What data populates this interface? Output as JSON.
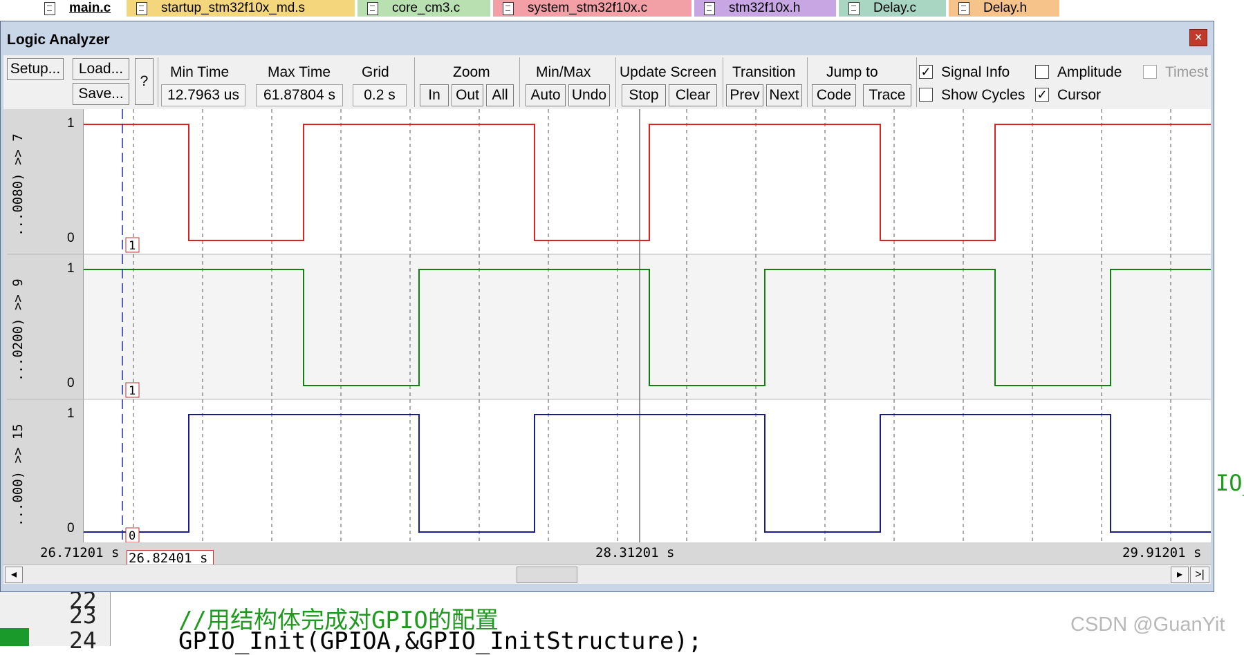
{
  "file_tabs": [
    {
      "label": "main.c",
      "color": "#ffffff",
      "active": true
    },
    {
      "label": "startup_stm32f10x_md.s",
      "color": "#f4d77c"
    },
    {
      "label": "core_cm3.c",
      "color": "#b9e0b0"
    },
    {
      "label": "system_stm32f10x.c",
      "color": "#f2a0a6"
    },
    {
      "label": "stm32f10x.h",
      "color": "#c8a6e4"
    },
    {
      "label": "Delay.c",
      "color": "#a9d6c2"
    },
    {
      "label": "Delay.h",
      "color": "#f6c38a"
    }
  ],
  "window": {
    "title": "Logic Analyzer",
    "close_label": "×"
  },
  "toolbar": {
    "setup_label": "Setup...",
    "load_label": "Load...",
    "save_label": "Save...",
    "help_label": "?",
    "min_time_label": "Min Time",
    "min_time_value": "12.7963 us",
    "max_time_label": "Max Time",
    "max_time_value": "61.87804 s",
    "grid_label": "Grid",
    "grid_value": "0.2 s",
    "zoom_label": "Zoom",
    "zoom_in": "In",
    "zoom_out": "Out",
    "zoom_all": "All",
    "minmax_label": "Min/Max",
    "minmax_auto": "Auto",
    "minmax_undo": "Undo",
    "update_label": "Update Screen",
    "update_stop": "Stop",
    "update_clear": "Clear",
    "transition_label": "Transition",
    "transition_prev": "Prev",
    "transition_next": "Next",
    "jump_label": "Jump to",
    "jump_code": "Code",
    "jump_trace": "Trace",
    "signal_info_label": "Signal Info",
    "signal_info_checked": "✓",
    "show_cycles_label": "Show Cycles",
    "amplitude_label": "Amplitude",
    "cursor_label": "Cursor",
    "cursor_checked": "✓",
    "timestamps_label": "Timest"
  },
  "signals": [
    {
      "name": "...0080) >> 7",
      "high": "1",
      "low": "0",
      "cursor_value": "1",
      "color": "#e02020"
    },
    {
      "name": "...0200) >> 9",
      "high": "1",
      "low": "0",
      "cursor_value": "1",
      "color": "#108010"
    },
    {
      "name": "...000) >> 15",
      "high": "1",
      "low": "0",
      "cursor_value": "0",
      "color": "#1a1a8a"
    }
  ],
  "time_axis": {
    "start": "26.71201  s",
    "cursor": "26.82401  s",
    "mid": "28.31201  s",
    "end": "29.91201  s"
  },
  "scrollbar": {
    "left_arrow": "◂",
    "right_arrow": "▸",
    "end_button": ">|"
  },
  "editor": {
    "lines": [
      {
        "num": "22",
        "text": ""
      },
      {
        "num": "23",
        "text": "//用结构体完成对GPIO的配置"
      },
      {
        "num": "24",
        "text": "GPIO_Init(GPIOA,&GPIO_InitStructure);"
      }
    ],
    "side_fragment": "IO_",
    "comment_color": "#1f9a1f"
  },
  "watermark": "CSDN @GuanYit"
}
